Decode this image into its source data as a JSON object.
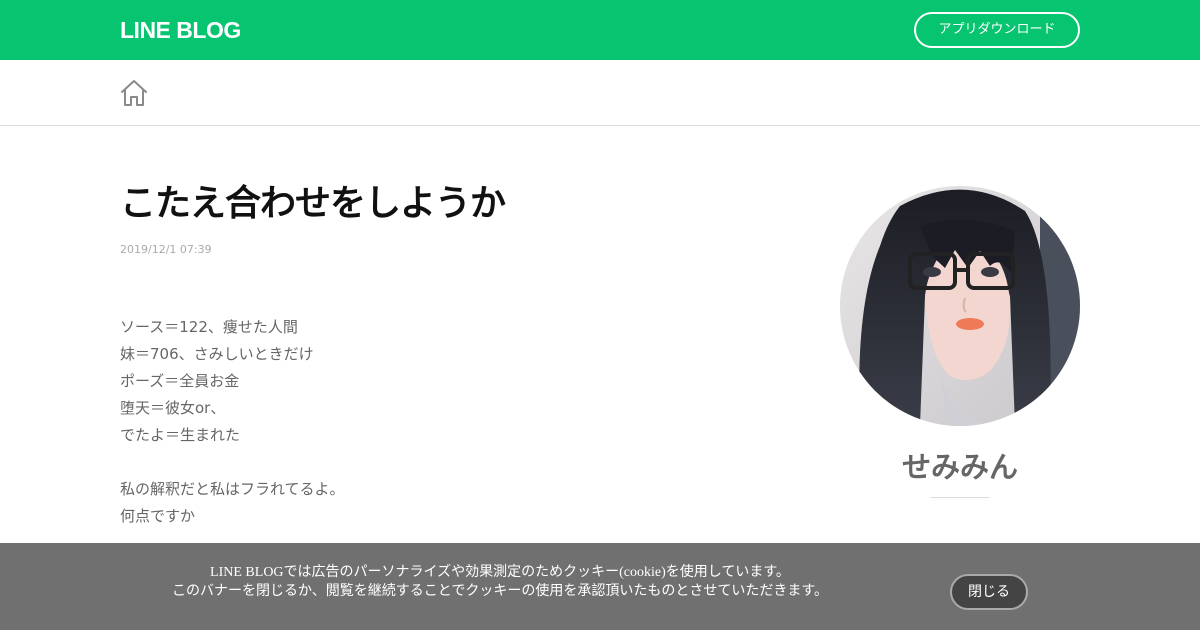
{
  "header": {
    "logo_text": "LINE BLOG",
    "app_download_label": "アプリダウンロード",
    "brand_color": "#06c46f"
  },
  "subnav": {
    "home_icon": "home-icon"
  },
  "post": {
    "title": "こたえ合わせをしようか",
    "date": "2019/12/1 07:39",
    "body_lines": [
      "ソース＝122、痩せた人間",
      "妹＝706、さみしいときだけ",
      "ポーズ＝全員お金",
      "堕天＝彼女or、",
      "でたよ＝生まれた",
      "",
      "私の解釈だと私はフラれてるよ。",
      "何点ですか"
    ]
  },
  "author": {
    "name": "せみみん"
  },
  "cookie_banner": {
    "line1": "LINE BLOGでは広告のパーソナライズや効果測定のためクッキー(cookie)を使用しています。",
    "line2": "このバナーを閉じるか、閲覧を継続することでクッキーの使用を承認頂いたものとさせていただきます。",
    "close_label": "閉じる"
  }
}
